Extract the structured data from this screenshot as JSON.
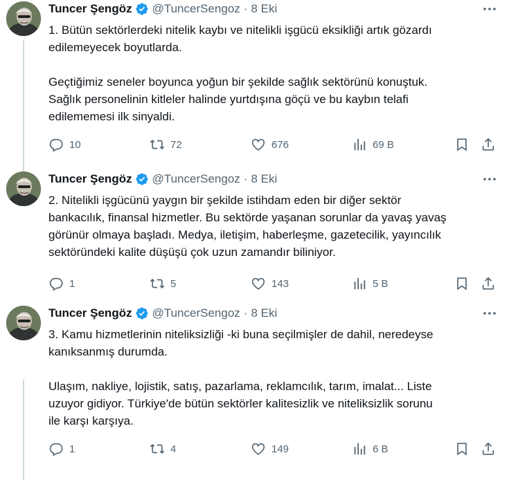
{
  "tweets": [
    {
      "author": "Tuncer Şengöz",
      "handle": "@TuncerSengoz",
      "separator": "·",
      "date": "8 Eki",
      "paragraphs": [
        [
          "1. Bütün sektörlerdeki nitelik kaybı ve nitelikli işgücü eksikliği artık gözardı",
          "edilemeyecek boyutlarda."
        ],
        [
          "Geçtiğimiz seneler boyunca yoğun bir şekilde sağlık sektörünü konuştuk.",
          "Sağlık personelinin kitleler halinde yurtdışına göçü ve bu kaybın telafi",
          "edilememesi ilk sinyaldi."
        ]
      ],
      "replies": "10",
      "reposts": "72",
      "likes": "676",
      "views": "69 B"
    },
    {
      "author": "Tuncer Şengöz",
      "handle": "@TuncerSengoz",
      "separator": "·",
      "date": "8 Eki",
      "paragraphs": [
        [
          "2. Nitelikli işgücünü yaygın bir şekilde istihdam eden bir diğer sektör",
          "bankacılık, finansal hizmetler. Bu sektörde yaşanan sorunlar da yavaş yavaş",
          "görünür olmaya başladı. Medya, iletişim, haberleşme, gazetecilik, yayıncılık",
          "sektöründeki kalite düşüşü çok uzun zamandır biliniyor."
        ]
      ],
      "replies": "1",
      "reposts": "5",
      "likes": "143",
      "views": "5 B"
    },
    {
      "author": "Tuncer Şengöz",
      "handle": "@TuncerSengoz",
      "separator": "·",
      "date": "8 Eki",
      "paragraphs": [
        [
          "3. Kamu hizmetlerinin niteliksizliği -ki buna seçilmişler de dahil, neredeyse",
          "kanıksanmış durumda."
        ],
        [
          "Ulaşım, nakliye, lojistik, satış, pazarlama, reklamcılık, tarım, imalat... Liste",
          "uzuyor gidiyor. Türkiye'de bütün sektörler kalitesizlik ve niteliksizlik sorunu",
          "ile karşı karşıya."
        ]
      ],
      "replies": "1",
      "reposts": "4",
      "likes": "149",
      "views": "6 B"
    }
  ],
  "colors": {
    "text": "#0f1419",
    "secondary": "#536471",
    "verified": "#1d9bf0",
    "thread_line": "#cfd9de"
  },
  "icons": [
    "verified-badge-icon",
    "more-icon",
    "reply-icon",
    "repost-icon",
    "like-icon",
    "views-icon",
    "bookmark-icon",
    "share-icon"
  ]
}
